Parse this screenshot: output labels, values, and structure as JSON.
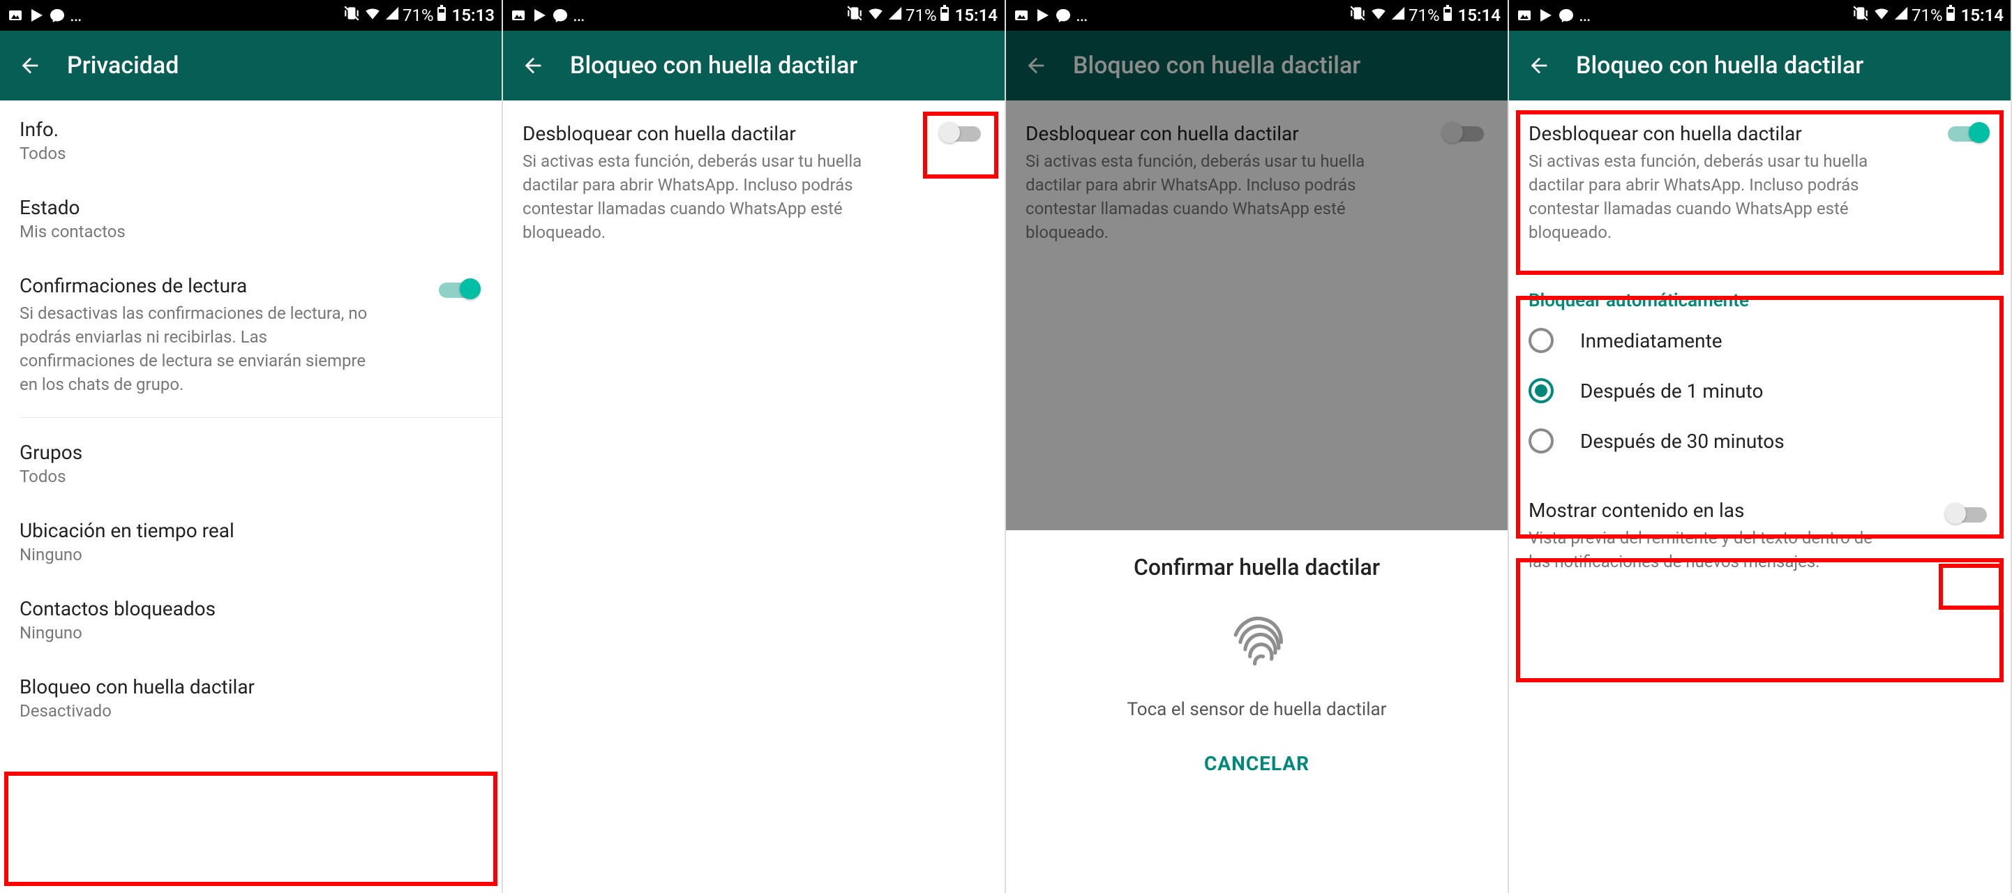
{
  "status": {
    "icons": [
      "gallery",
      "play",
      "messenger",
      "ellipsis"
    ],
    "battery_percent": "71%",
    "times": [
      "15:13",
      "15:14",
      "15:14",
      "15:14"
    ]
  },
  "s1": {
    "title": "Privacidad",
    "rows": [
      {
        "title": "Info.",
        "sub": "Todos"
      },
      {
        "title": "Estado",
        "sub": "Mis contactos"
      },
      {
        "title": "Confirmaciones de lectura",
        "sub": "Si desactivas las confirmaciones de lectura, no podrás enviarlas ni recibirlas. Las confirmaciones de lectura se enviarán siempre en los chats de grupo."
      },
      {
        "title": "Grupos",
        "sub": "Todos"
      },
      {
        "title": "Ubicación en tiempo real",
        "sub": "Ninguno"
      },
      {
        "title": "Contactos bloqueados",
        "sub": "Ninguno"
      },
      {
        "title": "Bloqueo con huella dactilar",
        "sub": "Desactivado"
      }
    ]
  },
  "s2": {
    "title": "Bloqueo con huella dactilar",
    "unlock_title": "Desbloquear con huella dactilar",
    "unlock_sub": "Si activas esta función, deberás usar tu huella dactilar para abrir WhatsApp. Incluso podrás contestar llamadas cuando WhatsApp esté bloqueado.",
    "toggle_on": false
  },
  "s3": {
    "title": "Bloqueo con huella dactilar",
    "unlock_title": "Desbloquear con huella dactilar",
    "unlock_sub": "Si activas esta función, deberás usar tu huella dactilar para abrir WhatsApp. Incluso podrás contestar llamadas cuando WhatsApp esté bloqueado.",
    "sheet_title": "Confirmar huella dactilar",
    "sheet_hint": "Toca el sensor de huella dactilar",
    "cancel": "CANCELAR"
  },
  "s4": {
    "title": "Bloqueo con huella dactilar",
    "unlock_title": "Desbloquear con huella dactilar",
    "unlock_sub": "Si activas esta función, deberás usar tu huella dactilar para abrir WhatsApp. Incluso podrás contestar llamadas cuando WhatsApp esté bloqueado.",
    "unlock_on": true,
    "auto_section": "Bloquear automáticamente",
    "auto_options": [
      "Inmediatamente",
      "Después de 1 minuto",
      "Después de 30 minutos"
    ],
    "auto_selected_index": 1,
    "show_title": "Mostrar contenido en las",
    "show_sub": "Vista previa del remitente y del texto dentro de las notificaciones de nuevos mensajes.",
    "show_on": false
  }
}
